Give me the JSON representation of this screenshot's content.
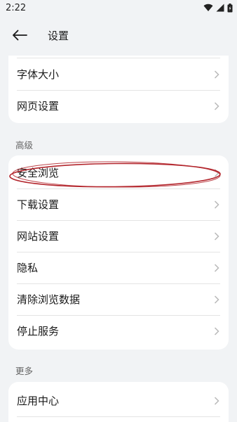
{
  "status_bar": {
    "time": "2:22"
  },
  "app_bar": {
    "title": "设置"
  },
  "card1": {
    "items": [
      {
        "label": "字体大小"
      },
      {
        "label": "网页设置"
      }
    ]
  },
  "section_advanced": {
    "label": "高级"
  },
  "card2": {
    "items": [
      {
        "label": "安全浏览"
      },
      {
        "label": "下载设置"
      },
      {
        "label": "网站设置"
      },
      {
        "label": "隐私"
      },
      {
        "label": "清除浏览数据"
      },
      {
        "label": "停止服务"
      }
    ]
  },
  "section_more": {
    "label": "更多"
  },
  "card3": {
    "items": [
      {
        "label": "应用中心"
      }
    ]
  },
  "colors": {
    "annotation": "#b3262d",
    "background": "#f1f3f5",
    "card": "#ffffff"
  }
}
